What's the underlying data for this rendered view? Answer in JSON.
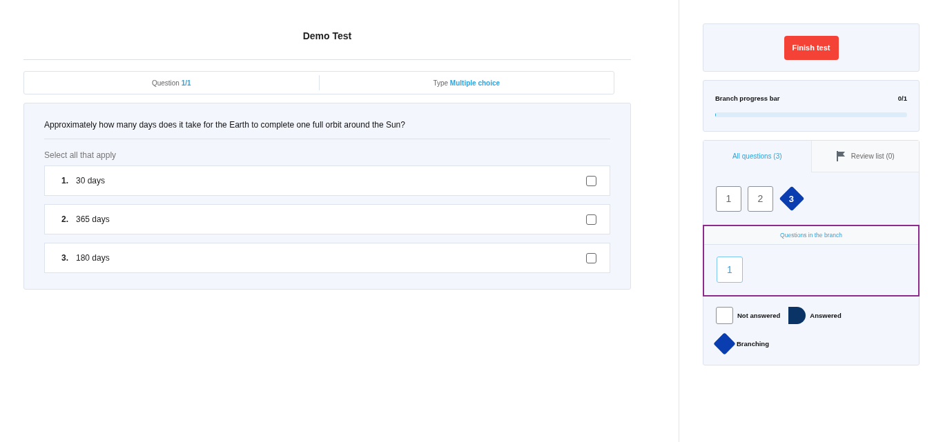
{
  "title": "Demo Test",
  "info": {
    "question_label": "Question",
    "question_value": "1/1",
    "type_label": "Type",
    "type_value": "Multiple choice"
  },
  "question": {
    "text": "Approximately how many days does it take for the Earth to complete one full orbit around the Sun?",
    "instruction": "Select all that apply",
    "options": [
      {
        "number": "1.",
        "text": "30 days",
        "checked": false
      },
      {
        "number": "2.",
        "text": "365 days",
        "checked": false
      },
      {
        "number": "3.",
        "text": "180 days",
        "checked": false
      }
    ]
  },
  "finish_button": "Finish test",
  "progress": {
    "label": "Branch progress bar",
    "count": "0/1",
    "level": 0
  },
  "tabs": [
    {
      "label": "All questions (3)",
      "selected": true,
      "icon": false
    },
    {
      "label": "Review list (0)",
      "selected": false,
      "icon": true
    }
  ],
  "navigator": [
    {
      "label": "1",
      "kind": "plain"
    },
    {
      "label": "2",
      "kind": "plain"
    },
    {
      "label": "3",
      "kind": "branching"
    }
  ],
  "branch": {
    "title": "Questions in the branch",
    "questions": [
      {
        "label": "1",
        "selected": true
      }
    ]
  },
  "legend": [
    {
      "label": "Not answered",
      "kind": "not-answered"
    },
    {
      "label": "Answered",
      "kind": "answered"
    },
    {
      "label": "Branching",
      "kind": "branching"
    }
  ]
}
